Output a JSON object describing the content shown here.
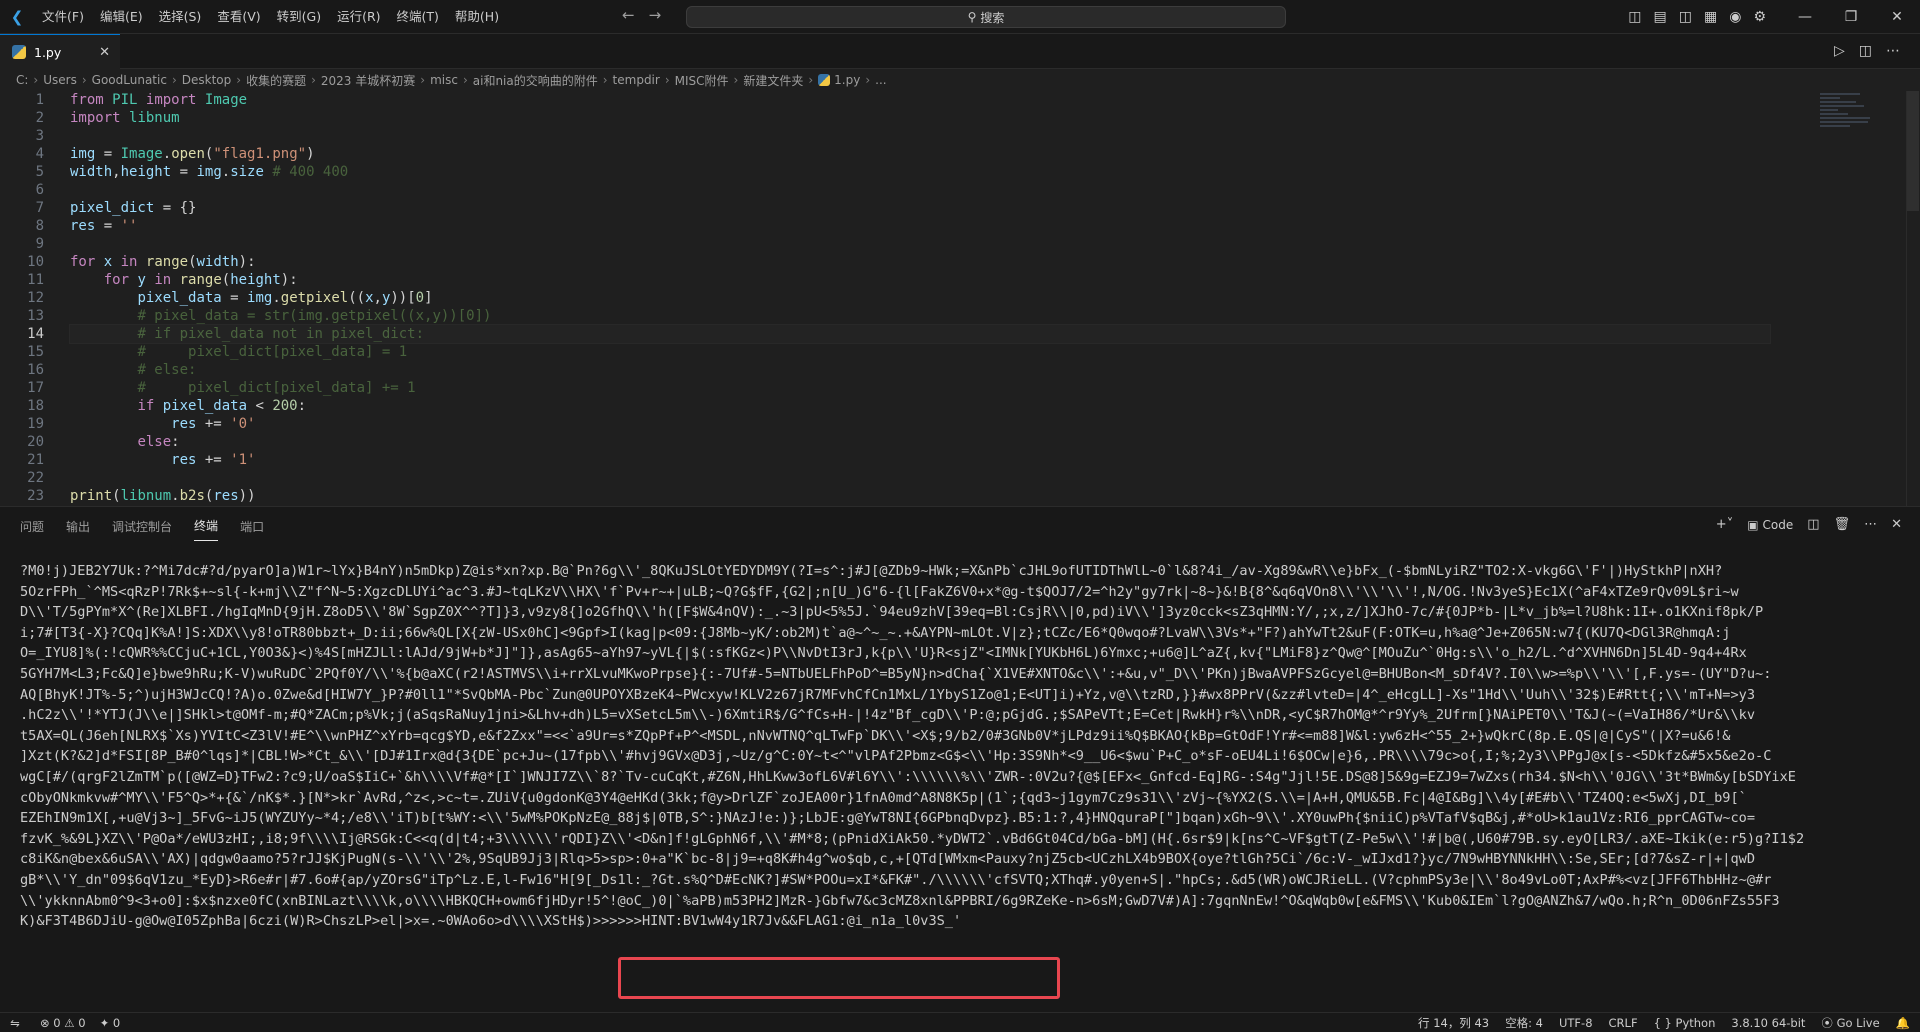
{
  "titlebar": {
    "menu": [
      "文件(F)",
      "编辑(E)",
      "选择(S)",
      "查看(V)",
      "转到(G)",
      "运行(R)",
      "终端(T)",
      "帮助(H)"
    ],
    "search_placeholder": "搜索"
  },
  "tab": {
    "label": "1.py"
  },
  "breadcrumb": [
    "C:",
    "Users",
    "GoodLunatic",
    "Desktop",
    "收集的赛题",
    "2023 羊城杯初赛",
    "misc",
    "ai和nia的交响曲的附件",
    "tempdir",
    "MISC附件",
    "新建文件夹",
    "1.py",
    "..."
  ],
  "editor": {
    "active_line": 14,
    "lines": [
      "from PIL import Image",
      "import libnum",
      "",
      "img = Image.open(\"flag1.png\")",
      "width,height = img.size # 400 400",
      "",
      "pixel_dict = {}",
      "res = ''",
      "",
      "for x in range(width):",
      "    for y in range(height):",
      "        pixel_data = img.getpixel((x,y))[0]",
      "        # pixel_data = str(img.getpixel((x,y))[0])",
      "        # if pixel_data not in pixel_dict:",
      "        #     pixel_dict[pixel_data] = 1",
      "        # else:",
      "        #     pixel_dict[pixel_data] += 1",
      "        if pixel_data < 200:",
      "            res += '0'",
      "        else:",
      "            res += '1'",
      "",
      "print(libnum.b2s(res))"
    ]
  },
  "panel": {
    "tabs": [
      "问题",
      "输出",
      "调试控制台",
      "终端",
      "端口"
    ],
    "active_tab": "终端",
    "terminal_label": "Code",
    "terminal_lines": [
      "?M0!j)JEB2Y7Uk:?^Mi7dc#?d/pyarO]a)W1r~lYx}B4nY)n5mDkp)Z@is*xn?xp.B@`Pn?6g\\\\'_8QKuJSLOtYEDYDM9Y(?I=s^:j#J[@ZDb9~HWk;=X&nPb`cJHL9ofUTIDThWlL~0`l&8?4i_/av-Xg89&wR\\\\e}bFx_(-$bmNLyiRZ\"TO2:X-vkg6G\\'F'|)HyStkhP|nXH?",
      "5OzrFPh_`^MS<qRzP!7Rk$+~sl{-k+mj\\\\Z\"f^N~5:XgzcDLUYi^ac^3.#J~tqLKzV\\\\HX\\'f`Pv+r~+|uLB;~Q?G$fF,{G2|;n[U_)G\"6-{l[FakZ6V0+x*@g-t$QOJ7/2=^h2y\"gy7rk|~8~}&!B{8^&q6qVOn8\\\\'\\\\'\\\\'!,N/OG.!Nv3yeS}Ec1X(^aF4xTZe9rQv09L$ri~w",
      "D\\\\'T/5gPYm*X^(Re]XLBFI./hgIqMnD{9jH.Z8oD5\\\\'8W`SgpZ0X^^?T]}3,v9zy8{]o2GfhQ\\\\'h([F$W&4nQV):_.~3|pU<5%5J.`94eu9zhV[39eq=Bl:CsjR\\\\|0,pd)iV\\\\']3yz0cck<sZ3qHMN:Y/,;x,z/]XJhO-7c/#{0JP*b-|L*v_jb%=l?U8hk:1I+.o1KXnif8pk/P",
      "i;7#[T3{-X}?CQq]K%A!]S:XDX\\\\y8!oTR80bbzt+_D:ii;66w%QL[X{zW-USx0hC]<9Gpf>I(kag|p<09:{J8Mb~yK/:ob2M)t`a@~^~_~.+&AYPN~mLOt.V|z};tCZc/E6*Q0wqo#?LvaW\\\\3Vs*+\"F?)ahYwTt2&uF(F:OTK=u,h%a@^Je+Z065N:w7{(KU7Q<DGl3R@hmqA:j",
      "O=_IYU8]%(:!cQWR%%CCjuC+1CL,Y0O3&}<)%4S[mHZJLl:lAJd/9jW+b*J]\"]},asAg65~aYh97~yVL{|$(:sfKGz<)P\\\\NvDtI3rJ,k{p\\\\'U}R<sjZ\"<IMNk[YUKbH6L)6Ymxc;+u6@]L^aZ{,kv{\"LMiF8}z^Qw@^[MOuZu^`0Hg:s\\\\'o_h2/L.^d^XVHN6Dn]5L4D-9q4+4Rx",
      "5GYH7M<L3;Fc&Q]e}bwe9hRu;K-V)wuRuDC`2PQf0Y/\\\\'%{b@aXC(r2!ASTMVS\\\\i+rrXLvuMKwoPrpse}{:-7Uf#-5=NTbUELFhPoD^=B5yN}n>dCha{`X1VE#XNTO&c\\\\':+&u,v\"_D\\\\'PKn)jBwaAVPFSzGcyel@=BHUBon<M_sDf4V?.I0\\\\w>=%p\\\\'\\\\'[,F.ys=-(UY\"D?u~:",
      "AQ[BhyK!JT%-5;^)ujH3WJcCQ!?A)o.0Zwe&d[HIW7Y_}P?#0ll1\"*SvQbMA-Pbc`Zun@0UPOYXBzeK4~PWcxyw!KLV2z67jR7MFvhCfCn1MxL/1YbyS1Zo@1;E<UT]i)+Yz,v@\\\\tzRD,}}#wx8PPrV(&zz#lvteD=|4^_eHcgLL]-Xs\"1Hd\\\\'Uuh\\\\'32$)E#Rtt{;\\\\'mT+N=>y3",
      ".hC2z\\\\'!*YTJ(J\\\\e|]SHkl>t@OMf-m;#Q*ZACm;p%Vk;j(aSqsRaNuy1jni>&Lhv+dh)L5=vXSetcL5m\\\\-)6XmtiR$/G^fCs+H-|!4z\"Bf_cgD\\\\'P:@;pGjdG.;$SAPeVTt;E=Cet|RwkH}r%\\\\nDR,<yC$R7hOM@*^r9Yy%_2Ufrm[}NAiPET0\\\\'T&J(~(=VaIH86/*Ur&\\\\kv",
      "t5AX=QL(J6eh[NLRX$`Xs)YVItC<Z3lV!#E^\\\\wnPHZ^xYrb=qcg$YD,e&f2Zxx\"=<<`a9Ur=s*ZQpPf+P^<MSDL,nNvWTNQ^qLTwFp`DK\\\\'<X$;9/b2/0#3GNb0V*jLPdz9ii%Q$BKAO{kBp=GtOdF!Yr#<=m88]W&l:yw6zH<^55_2+}wQkrC(8p.E.QS|@|CyS\"(|X?=u&6!&",
      "]Xzt(K?&2]d*FSI[8P_B#0^lqs]*|CBL!W>*Ct_&\\\\'[DJ#1Irx@d{3{DE`pc+Ju~(17fpb\\\\'#hvj9GVx@D3j,~Uz/g^C:0Y~t<^\"vlPAf2Pbmz<G$<\\\\'Hp:3S9Nh*<9__U6<$wu`P+C_o*sF-oEU4Li!6$OCw|e}6,.PR\\\\\\\\79c>o{,I;%;2y3\\\\PPgJ@x[s-<5Dkfz&#5x5&e2o-C",
      "wgC[#/(qrgF2lZmTM`p([@WZ=D}TFw2:?c9;U/oaS$IiC+`&h\\\\\\\\Vf#@*[I`]WNJI7Z\\\\`8?`Tv-cuCqKt,#Z6N,HhLKww3ofL6V#l6Y\\\\':\\\\\\\\\\\\%\\\\'ZWR-:0V2u?{@$[EFx<_Gnfcd-Eq]RG-:S4g\"Jjl!5E.DS@8]5&9g=EZJ9=7wZxs(rh34.$N<h\\\\'0JG\\\\'3t*BWm&y[bSDYixE",
      "cObyONkmkvw#^MY\\\\'F5^Q>*+{&`/nK$*.}[N*>kr`AvRd,^z<,>c~t=.ZUiV{u0gdonK@3Y4@eHKd(3kk;f@y>DrlZF`zoJEA00r}1fnA0md^A8N8K5p|(1`;{qd3~j1gym7Cz9s31\\\\'zVj~{%YX2(S.\\\\=|A+H,QMU&5B.Fc|4@I&Bg]\\\\4y[#E#b\\\\'TZ4OQ:e<5wXj,DI_b9[`",
      "EZEhIN9m1X[,+u@Vj3~]_5FvG~iJ5(WYZUYy~*4;/e8\\\\'iT)b[t%WY:<\\\\'5wM%POKpNzE@_88j$|0TB,S^:}NAzJ!e:)};LbJE:g@YwT8NI{6GPbnqDvpz}.B5:1:?,4}HNQquraP[\"]bqan)xGh~9\\\\'.XY0uwPh{$niiC)p%VTafV$qB&j,#*oU>k1au1Vz:RI6_pprCAGTw~co=",
      "fzvK_%&9L}XZ\\\\'P@Oa*/eWU3zHI;,i8;9f\\\\\\\\Ij@RSGk:C<<q(d|t4;+3\\\\\\\\\\\\'rQDI}Z\\\\'<D&n]f!gLGphN6f,\\\\'#M*8;(pPnidXiAk50.*yDWT2`.vBd6Gt04Cd/bGa-bM](H{.6sr$9|k[ns^C~VF$gtT(Z-Pe5w\\\\'!#|b@(,U60#79B.sy.eyO[LR3/.aXE~Ikik(e:r5)g?I1$2",
      "c8iK&n@bex&6uSA\\\\'AX)|qdgw0aamo?5?rJJ$KjPugN(s-\\\\'\\\\'2%,9SqUB9Jj3|Rlq>5>sp>:0+a\"K`bc-8|j9=+q8K#h4g^wo$qb,c,+[QTd[WMxm<Pauxy?njZ5cb<UCzhLX4b9BOX{oye?tlGh?5Ci`/6c:V-_wIJxd1?}yc/7N9wHBYNNkHH\\\\:Se,SEr;[d?7&sZ-r|+|qwD",
      "gB*\\\\'Y_dn\"09$6qV1zu_*EyD}>R6e#r|#7.6o#{ap/yZOrsG\"iTp^Lz.E,l-Fw16\"H[9[_Ds1l:_?Gt.s%Q^D#EcNK?]#SW*POOu=xI*&FK#\"./\\\\\\\\\\\\'cfSVTQ;XThq#.y0yen+S|.\"hpCs;.&d5(WR)oWCJRieLL.(V?cphmPSy3e|\\\\'8o49vLo0T;AxP#%<vz[JFF6ThbHHz~@#r",
      "\\\\'ykknnAbm0^9<3+o0]:$x$nzxe0fC(xnBINLazt\\\\\\\\k,o\\\\\\\\HBKQCH+owm6fjHDyr!5^!@oC_)0|`%aPB)m53PH2]MzR-}Gbfw7&c3cMZ8xnl&PPBRI/6g9RZeKe-n>6sM;GwD7V#)A]:7gqnNnEw!^O&qWqb0w[e&FMS\\\\'Kub0&IEm`l?gO@ANZh&7/wQo.h;R^n_0D06nFZs55F3",
      "K)&F3T4B6DJiU-g@Ow@I05ZphBa|6czi(W)R>ChszLP>el|>x=.~0WAo6o>d\\\\\\\\XStH$)>>>>>>HINT:BV1wW4y1R7Jv&&FLAG1:@i_n1a_l0v3S_'"
    ]
  },
  "statusbar": {
    "errors": "0",
    "warnings": "0",
    "ports": "0",
    "cursor": "行 14，列 43",
    "spaces": "空格: 4",
    "encoding": "UTF-8",
    "eol": "CRLF",
    "language": "Python",
    "interpreter": "3.8.10 64-bit",
    "golive": "Go Live"
  },
  "colors": {
    "accent": "#0078d4",
    "highlight_box": "#e8464f"
  }
}
